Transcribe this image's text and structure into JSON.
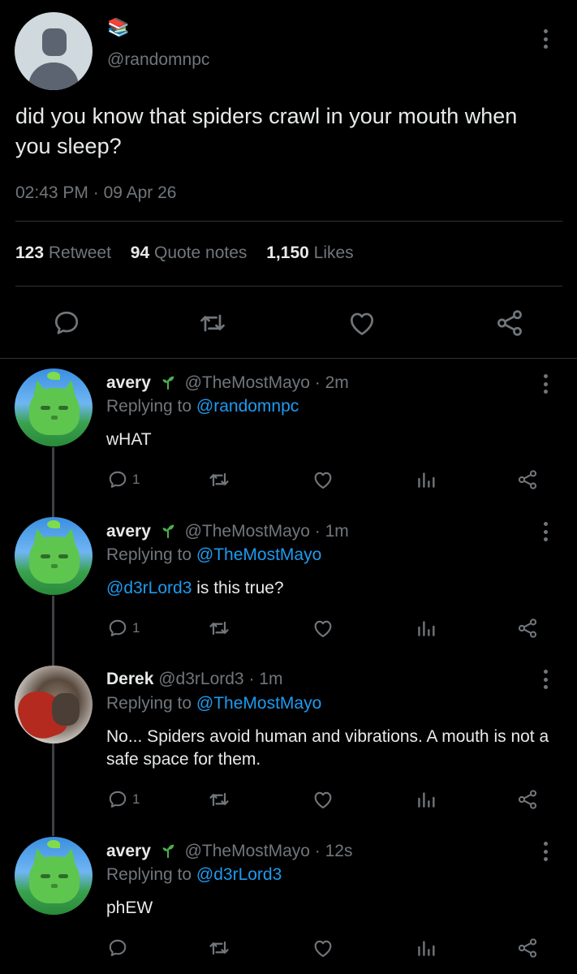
{
  "main_tweet": {
    "emoji": "📚",
    "handle": "@randomnpc",
    "text": "did you know that spiders crawl in your mouth when you sleep?",
    "time": "02:43 PM",
    "date_sep": "·",
    "date": "09 Apr 26",
    "retweet_count": "123",
    "retweet_label": "Retweet",
    "quote_count": "94",
    "quote_label": "Quote notes",
    "like_count": "1,150",
    "like_label": "Likes"
  },
  "replies": [
    {
      "name": "avery",
      "handle": "@TheMostMayo",
      "time": "· 2m",
      "replying_label": "Replying to",
      "replying_to": "@randomnpc",
      "mention": "",
      "text": "wHAT",
      "reply_count": "1"
    },
    {
      "name": "avery",
      "handle": "@TheMostMayo",
      "time": "· 1m",
      "replying_label": "Replying to",
      "replying_to": "@TheMostMayo",
      "mention": "@d3rLord3",
      "text": " is this true?",
      "reply_count": "1"
    },
    {
      "name": "Derek",
      "handle": "@d3rLord3",
      "time": "· 1m",
      "replying_label": "Replying to",
      "replying_to": "@TheMostMayo",
      "mention": "",
      "text": "No... Spiders avoid human and vibrations. A mouth is not a safe space for them.",
      "reply_count": "1"
    },
    {
      "name": "avery",
      "handle": "@TheMostMayo",
      "time": "· 12s",
      "replying_label": "Replying to",
      "replying_to": "@d3rLord3",
      "mention": "",
      "text": "phEW",
      "reply_count": ""
    }
  ],
  "colors": {
    "background": "#000000",
    "text": "#e7e9ea",
    "muted": "#71767b",
    "link": "#1d9bf0",
    "divider": "#2f3336",
    "sprout": "#4caf50"
  }
}
